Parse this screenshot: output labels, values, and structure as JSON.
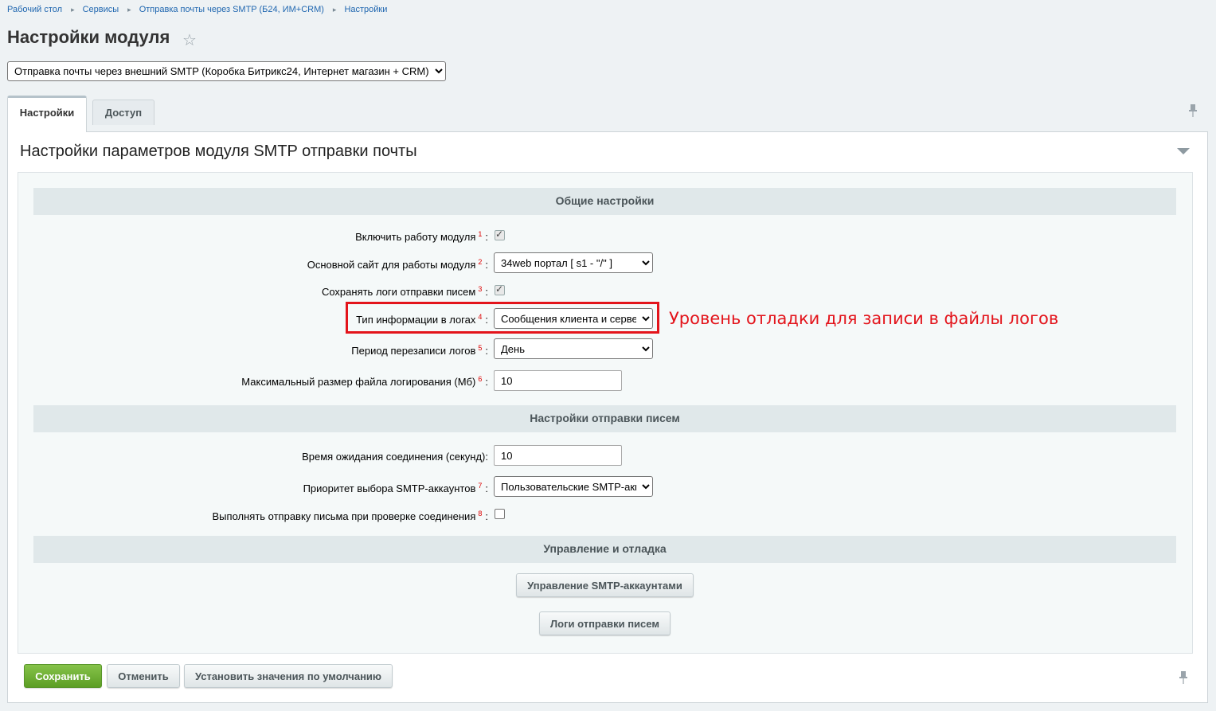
{
  "breadcrumb": [
    "Рабочий стол",
    "Сервисы",
    "Отправка почты через SMTP (Б24, ИМ+CRM)",
    "Настройки"
  ],
  "page_title": "Настройки модуля",
  "module_select": {
    "value": "Отправка почты через внешний SMTP (Коробка Битрикс24, Интернет магазин + CRM)"
  },
  "tabs": [
    {
      "label": "Настройки",
      "active": true
    },
    {
      "label": "Доступ",
      "active": false
    }
  ],
  "panel_title": "Настройки параметров модуля SMTP отправки почты",
  "sections": {
    "general": "Общие настройки",
    "sending": "Настройки отправки писем",
    "management": "Управление и отладка"
  },
  "fields": {
    "enable_module": {
      "label": "Включить работу модуля",
      "num": "1",
      "checked": true
    },
    "main_site": {
      "label": "Основной сайт для работы модуля",
      "num": "2",
      "value": "34web портал [ s1 - \"/\" ]"
    },
    "save_logs": {
      "label": "Сохранять логи отправки писем",
      "num": "3",
      "checked": true
    },
    "log_info_type": {
      "label": "Тип информации в логах",
      "num": "4",
      "value": "Сообщения клиента и сервера"
    },
    "log_rewrite_period": {
      "label": "Период перезаписи логов",
      "num": "5",
      "value": "День"
    },
    "max_log_size": {
      "label": "Максимальный размер файла логирования (Мб)",
      "num": "6",
      "value": "10"
    },
    "connect_timeout": {
      "label": "Время ожидания соединения (секунд):",
      "value": "10"
    },
    "smtp_priority": {
      "label": "Приоритет выбора SMTP-аккаунтов",
      "num": "7",
      "value": "Пользовательские SMTP-аккаунты"
    },
    "send_on_check": {
      "label": "Выполнять отправку письма при проверке соединения",
      "num": "8",
      "checked": false
    }
  },
  "annotation": "Уровень отладки для записи в файлы логов",
  "buttons": {
    "manage_accounts": "Управление SMTP-аккаунтами",
    "send_logs": "Логи отправки писем",
    "save": "Сохранить",
    "cancel": "Отменить",
    "defaults": "Установить значения по умолчанию"
  },
  "colors": {
    "accent_link": "#2067b0",
    "save_green": "#6aab2f",
    "annotation_red": "#e3141b"
  }
}
